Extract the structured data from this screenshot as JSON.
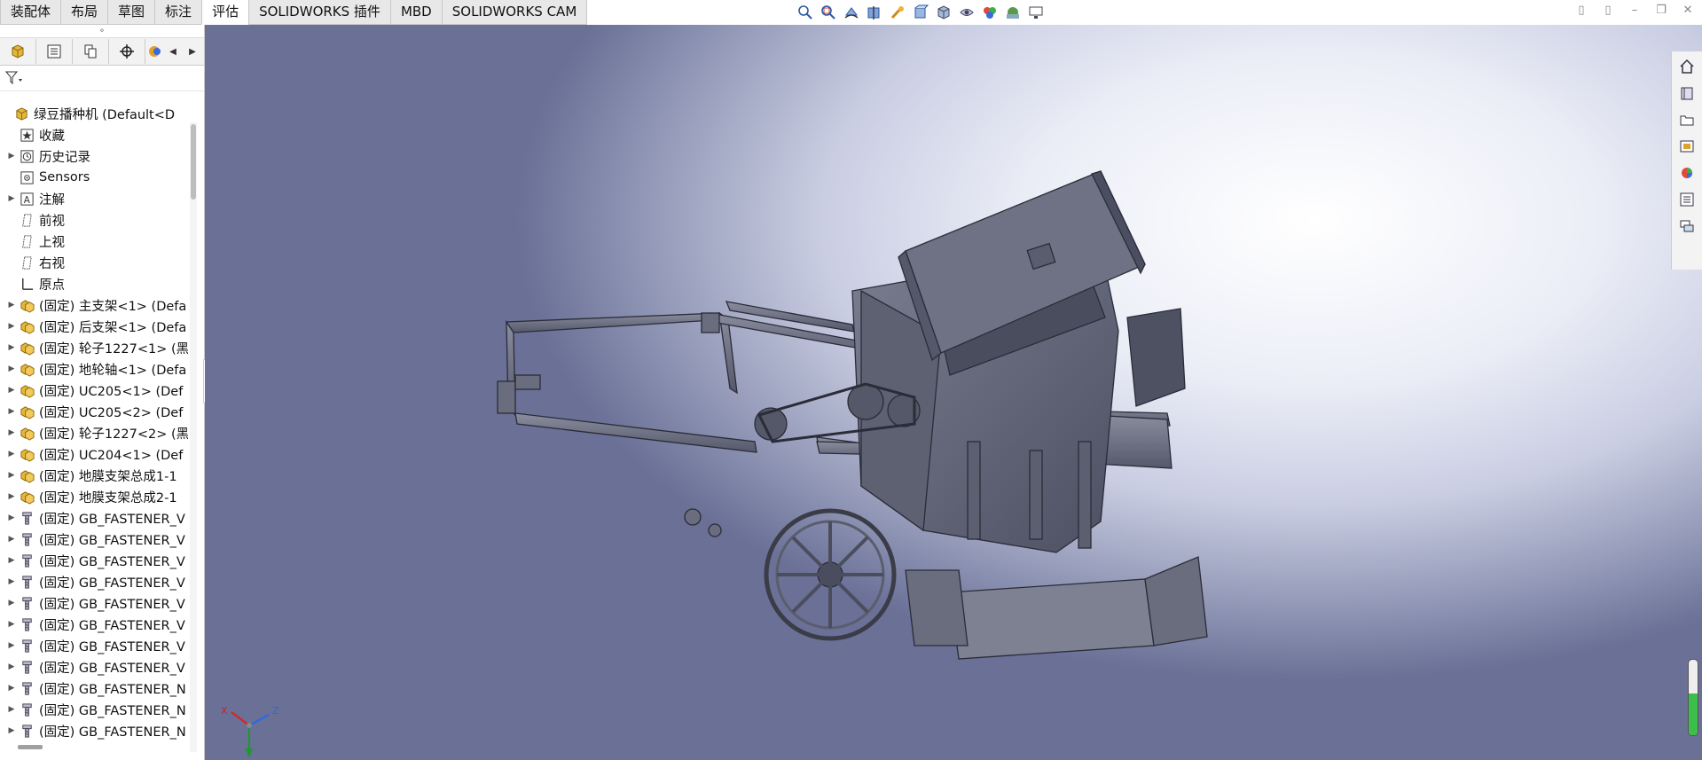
{
  "tabs": [
    "装配体",
    "布局",
    "草图",
    "标注",
    "评估",
    "SOLIDWORKS 插件",
    "MBD",
    "SOLIDWORKS CAM"
  ],
  "active_tab": "评估",
  "view_tools": [
    "zoom-to-fit-icon",
    "zoom-area-icon",
    "previous-view-icon",
    "section-view-icon",
    "dynamic-annotation-icon",
    "view-orientation-icon",
    "display-style-icon",
    "hide-show-icon",
    "edit-appearance-icon",
    "apply-scene-icon",
    "view-settings-icon"
  ],
  "feature_manager": {
    "tab_icons": [
      "feature-manager-icon",
      "property-manager-icon",
      "configuration-manager-icon",
      "dimxpert-icon",
      "display-manager-icon"
    ],
    "tree": [
      {
        "label": "绿豆播种机  (Default<D",
        "icon": "assembly-icon",
        "expander": "",
        "indent": 0
      },
      {
        "label": "收藏",
        "icon": "favorites-icon",
        "expander": "",
        "indent": 1
      },
      {
        "label": "历史记录",
        "icon": "history-icon",
        "expander": "▶",
        "indent": 1
      },
      {
        "label": "Sensors",
        "icon": "sensors-icon",
        "expander": "",
        "indent": 1
      },
      {
        "label": "注解",
        "icon": "annotations-icon",
        "expander": "▶",
        "indent": 1
      },
      {
        "label": "前视",
        "icon": "plane-icon",
        "expander": "",
        "indent": 1
      },
      {
        "label": "上视",
        "icon": "plane-icon",
        "expander": "",
        "indent": 1
      },
      {
        "label": "右视",
        "icon": "plane-icon",
        "expander": "",
        "indent": 1
      },
      {
        "label": "原点",
        "icon": "origin-icon",
        "expander": "",
        "indent": 1
      },
      {
        "label": "(固定) 主支架<1> (Defa",
        "icon": "subassembly-icon",
        "expander": "▶",
        "indent": 1
      },
      {
        "label": "(固定) 后支架<1> (Defa",
        "icon": "subassembly-icon",
        "expander": "▶",
        "indent": 1
      },
      {
        "label": "(固定) 轮子1227<1> (黑",
        "icon": "subassembly-icon",
        "expander": "▶",
        "indent": 1
      },
      {
        "label": "(固定) 地轮轴<1> (Defa",
        "icon": "subassembly-icon",
        "expander": "▶",
        "indent": 1
      },
      {
        "label": "(固定) UC205<1> (Def",
        "icon": "subassembly-icon",
        "expander": "▶",
        "indent": 1
      },
      {
        "label": "(固定) UC205<2> (Def",
        "icon": "subassembly-icon",
        "expander": "▶",
        "indent": 1
      },
      {
        "label": "(固定) 轮子1227<2> (黑",
        "icon": "subassembly-icon",
        "expander": "▶",
        "indent": 1
      },
      {
        "label": "(固定) UC204<1> (Def",
        "icon": "subassembly-icon",
        "expander": "▶",
        "indent": 1
      },
      {
        "label": "(固定) 地膜支架总成1-1",
        "icon": "subassembly-icon",
        "expander": "▶",
        "indent": 1
      },
      {
        "label": "(固定) 地膜支架总成2-1",
        "icon": "subassembly-icon",
        "expander": "▶",
        "indent": 1
      },
      {
        "label": "(固定) GB_FASTENER_V",
        "icon": "fastener-icon",
        "expander": "▶",
        "indent": 1
      },
      {
        "label": "(固定) GB_FASTENER_V",
        "icon": "fastener-icon",
        "expander": "▶",
        "indent": 1
      },
      {
        "label": "(固定) GB_FASTENER_V",
        "icon": "fastener-icon",
        "expander": "▶",
        "indent": 1
      },
      {
        "label": "(固定) GB_FASTENER_V",
        "icon": "fastener-icon",
        "expander": "▶",
        "indent": 1
      },
      {
        "label": "(固定) GB_FASTENER_V",
        "icon": "fastener-icon",
        "expander": "▶",
        "indent": 1
      },
      {
        "label": "(固定) GB_FASTENER_V",
        "icon": "fastener-icon",
        "expander": "▶",
        "indent": 1
      },
      {
        "label": "(固定) GB_FASTENER_V",
        "icon": "fastener-icon",
        "expander": "▶",
        "indent": 1
      },
      {
        "label": "(固定) GB_FASTENER_V",
        "icon": "fastener-icon",
        "expander": "▶",
        "indent": 1
      },
      {
        "label": "(固定) GB_FASTENER_N",
        "icon": "fastener-icon",
        "expander": "▶",
        "indent": 1
      },
      {
        "label": "(固定) GB_FASTENER_N",
        "icon": "fastener-icon",
        "expander": "▶",
        "indent": 1
      },
      {
        "label": "(固定) GB_FASTENER_N",
        "icon": "fastener-icon",
        "expander": "▶",
        "indent": 1
      }
    ]
  },
  "triad": {
    "x": "X",
    "y": "Y",
    "z": "Z"
  },
  "task_pane_icons": [
    "home-icon",
    "design-library-icon",
    "file-explorer-icon",
    "view-palette-icon",
    "appearances-icon",
    "custom-properties-icon",
    "forum-icon"
  ],
  "colors": {
    "model": "#6b6e7e",
    "model_dark": "#3f4150",
    "accent_green": "#3cbf4a"
  }
}
